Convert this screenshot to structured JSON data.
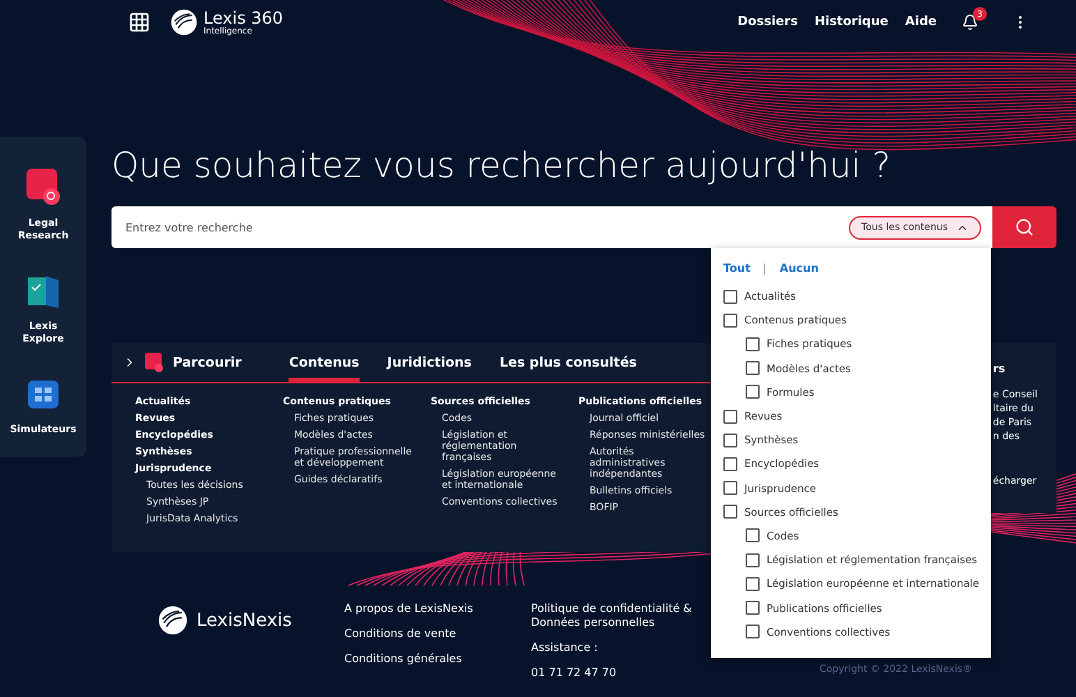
{
  "header": {
    "brand": "Lexis 360",
    "brand_sub": "Intelligence",
    "nav": [
      "Dossiers",
      "Historique",
      "Aide"
    ],
    "notifications": "3"
  },
  "sidebar": [
    {
      "kind": "research",
      "label": "Legal Research"
    },
    {
      "kind": "explore",
      "label": "Lexis Explore"
    },
    {
      "kind": "simulators",
      "label": "Simulateurs"
    }
  ],
  "heading": "Que souhaitez vous rechercher aujourd'hui ?",
  "search": {
    "placeholder": "Entrez votre recherche",
    "scope": "Tous les contenus",
    "scope_expanded": true
  },
  "scope_menu": {
    "links": [
      "Tout",
      "Aucun"
    ],
    "options": [
      {
        "label": "Actualités",
        "checked": false
      },
      {
        "label": "Contenus pratiques",
        "checked": false,
        "children": [
          {
            "label": "Fiches pratiques",
            "checked": false
          },
          {
            "label": "Modèles d'actes",
            "checked": false
          },
          {
            "label": "Formules",
            "checked": false
          }
        ]
      },
      {
        "label": "Revues",
        "checked": false
      },
      {
        "label": "Synthèses",
        "checked": false
      },
      {
        "label": "Encyclopédies",
        "checked": false
      },
      {
        "label": "Jurisprudence",
        "checked": false
      },
      {
        "label": "Sources officielles",
        "checked": false,
        "children": [
          {
            "label": "Codes",
            "checked": false
          },
          {
            "label": "Législation et réglementation françaises",
            "checked": false
          },
          {
            "label": "Législation européenne et internationale",
            "checked": false
          },
          {
            "label": "Publications officielles",
            "checked": false
          },
          {
            "label": "Conventions collectives",
            "checked": false
          }
        ]
      }
    ]
  },
  "browse": {
    "title": "Parcourir",
    "tabs": [
      {
        "label": "Contenus",
        "selected": true
      },
      {
        "label": "Juridictions",
        "selected": false
      },
      {
        "label": "Les plus consultés",
        "selected": false
      }
    ],
    "columns": [
      [
        {
          "label": "Actualités"
        },
        {
          "label": "Revues"
        },
        {
          "label": "Encyclopédies"
        },
        {
          "label": "Synthèses"
        },
        {
          "label": "Jurisprudence",
          "children": [
            "Toutes les décisions",
            "Synthèses JP",
            "JurisData Analytics"
          ]
        }
      ],
      [
        {
          "label": "Contenus pratiques",
          "children": [
            "Fiches pratiques",
            "Modèles d'actes",
            "Pratique professionnelle et développement",
            "Guides déclaratifs"
          ]
        }
      ],
      [
        {
          "label": "Sources officielles",
          "children": [
            "Codes",
            "Législation et réglementation françaises",
            "Législation européenne et internationale",
            "Conventions collectives"
          ]
        }
      ],
      [
        {
          "label": "Publications officielles",
          "children": [
            "Journal officiel",
            "Réponses ministérielles",
            "Autorités administratives indépendantes",
            "Bulletins officiels",
            "BOFIP"
          ]
        }
      ]
    ]
  },
  "side_card": {
    "title": "rs",
    "lines": [
      "e Conseil",
      "ltaire du",
      "de Paris",
      "n des"
    ],
    "link": "écharger"
  },
  "footer": {
    "brand": "LexisNexis",
    "links": [
      "A propos de LexisNexis",
      "Conditions de vente",
      "Conditions générales"
    ],
    "privacy": "Politique de confidentialité & Données personnelles",
    "assistance": "Assistance :",
    "phone": "01 71 72 47 70",
    "copyright": "Copyright © 2022 LexisNexis®"
  }
}
